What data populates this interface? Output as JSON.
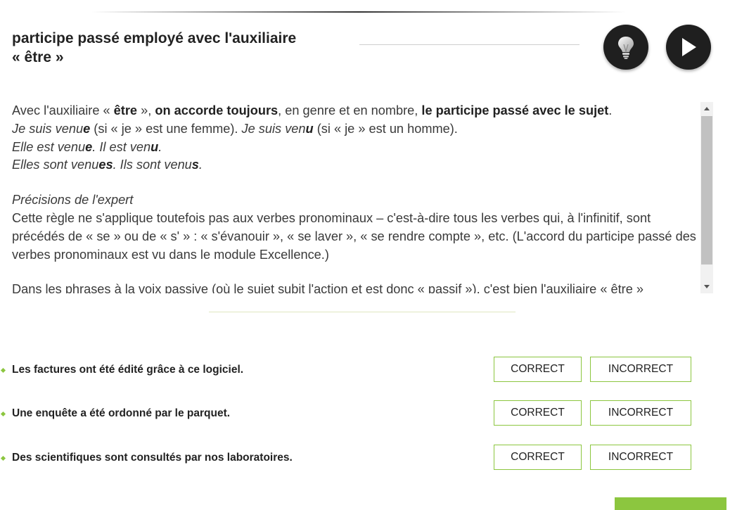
{
  "title_line1": "participe passé employé avec l'auxiliaire",
  "title_line2": "« être »",
  "accent_color": "#8cc63f",
  "icons": {
    "hint": "lightbulb-icon",
    "play": "play-icon"
  },
  "content": {
    "intro_1": "Avec l'auxiliaire « ",
    "intro_2": "être",
    "intro_3": " », ",
    "intro_4": "on accorde toujours",
    "intro_5": ", en genre et en nombre, ",
    "intro_6": "le participe passé avec le sujet",
    "intro_7": ".",
    "ex1_a": "Je suis venu",
    "ex1_b": "e",
    "ex1_c": " (si « je » est une femme). ",
    "ex1_d": "Je suis ven",
    "ex1_e": "u",
    "ex1_f": " (si « je » est un homme).",
    "ex2_a": "Elle est venu",
    "ex2_b": "e",
    "ex2_c": ". Il est ven",
    "ex2_d": "u",
    "ex2_e": ".",
    "ex3_a": "Elles sont venu",
    "ex3_b": "es",
    "ex3_c": ". Ils sont venu",
    "ex3_d": "s",
    "ex3_e": ".",
    "expert_heading": "Précisions de l'expert",
    "expert_text": "Cette règle ne s'applique toutefois pas aux verbes pronominaux – c'est-à-dire tous les verbes qui, à l'infinitif, sont précédés de « se » ou de « s' » : « s'évanouir », « se laver », « se rendre compte », etc. (L'accord du participe passé des verbes pronominaux est vu dans le module Excellence.)",
    "passive_text": "Dans les phrases à la voix passive (où le sujet subit l'action et est donc « passif »), c'est bien l'auxiliaire « être »"
  },
  "questions": [
    {
      "text": "Les factures ont été édité grâce à ce logiciel.",
      "correct_label": "CORRECT",
      "incorrect_label": "INCORRECT"
    },
    {
      "text": "Une enquête a été ordonné par le parquet.",
      "correct_label": "CORRECT",
      "incorrect_label": "INCORRECT"
    },
    {
      "text": "Des scientifiques sont consultés par nos laboratoires.",
      "correct_label": "CORRECT",
      "incorrect_label": "INCORRECT"
    }
  ]
}
